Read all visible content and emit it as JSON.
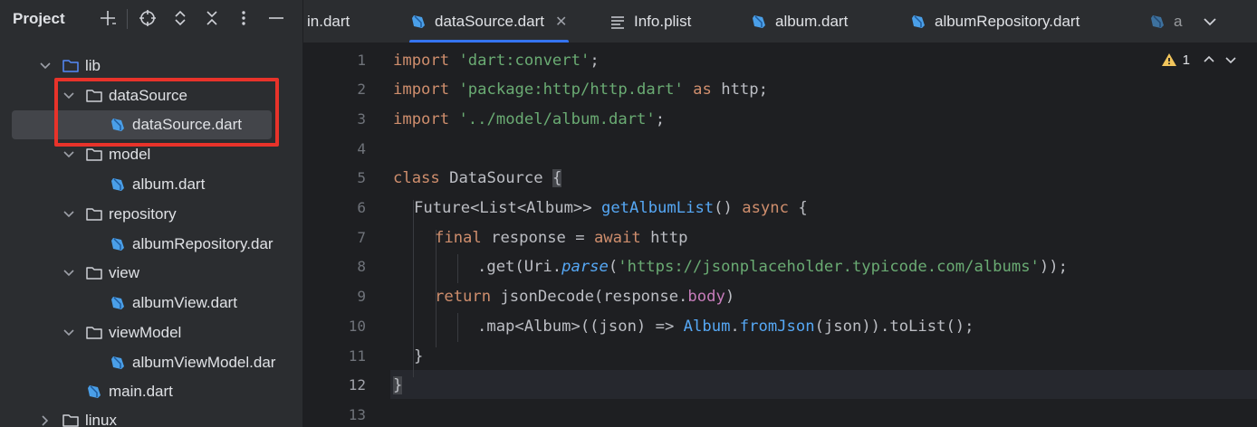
{
  "project_panel": {
    "title": "Project",
    "tree": [
      {
        "label": "lib",
        "type": "folder",
        "expanded": true,
        "depth": 0
      },
      {
        "label": "dataSource",
        "type": "folder",
        "expanded": true,
        "depth": 1
      },
      {
        "label": "dataSource.dart",
        "type": "dart-file",
        "depth": 2,
        "selected": true
      },
      {
        "label": "model",
        "type": "folder",
        "expanded": true,
        "depth": 1
      },
      {
        "label": "album.dart",
        "type": "dart-file",
        "depth": 2
      },
      {
        "label": "repository",
        "type": "folder",
        "expanded": true,
        "depth": 1
      },
      {
        "label": "albumRepository.dar",
        "type": "dart-file",
        "depth": 2
      },
      {
        "label": "view",
        "type": "folder",
        "expanded": true,
        "depth": 1
      },
      {
        "label": "albumView.dart",
        "type": "dart-file",
        "depth": 2
      },
      {
        "label": "viewModel",
        "type": "folder",
        "expanded": true,
        "depth": 1
      },
      {
        "label": "albumViewModel.dar",
        "type": "dart-file",
        "depth": 2
      },
      {
        "label": "main.dart",
        "type": "dart-file",
        "depth": 1
      },
      {
        "label": "linux",
        "type": "folder",
        "expanded": false,
        "depth": 0
      }
    ],
    "header_icons": [
      "add-icon",
      "target-icon",
      "expand-all-icon",
      "collapse-all-icon",
      "more-icon",
      "minimize-icon"
    ]
  },
  "tabs": [
    {
      "label": "in.dart",
      "icon": "none"
    },
    {
      "label": "dataSource.dart",
      "icon": "dart-icon",
      "active": true,
      "close": "✕"
    },
    {
      "label": "Info.plist",
      "icon": "plist-icon"
    },
    {
      "label": "album.dart",
      "icon": "dart-icon"
    },
    {
      "label": "albumRepository.dart",
      "icon": "dart-icon"
    },
    {
      "label": "a",
      "icon": "dart-icon"
    }
  ],
  "editor": {
    "inspection_count": "1",
    "current_line": 12,
    "line_numbers": [
      "1",
      "2",
      "3",
      "4",
      "5",
      "6",
      "7",
      "8",
      "9",
      "10",
      "11",
      "12",
      "13"
    ],
    "code": {
      "l1_kw": "import",
      "l1_str": "'dart:convert'",
      "l1_end": ";",
      "l2_kw": "import",
      "l2_str": "'package:http/http.dart'",
      "l2_as": "as",
      "l2_rest": "http;",
      "l3_kw": "import",
      "l3_str": "'../model/album.dart'",
      "l3_end": ";",
      "l5_kw": "class",
      "l5_name": "DataSource",
      "l5_brace": "{",
      "l6_type": "Future<List<Album>>",
      "l6_fn": "getAlbumList",
      "l6_paren": "()",
      "l6_async": "async",
      "l6_brace": "{",
      "l7_final": "final",
      "l7_mid": "response =",
      "l7_await": "await",
      "l7_rest": "http",
      "l8_a": ".get(Uri.",
      "l8_parse": "parse",
      "l8_b": "(",
      "l8_str": "'https://jsonplaceholder.typicode.com/albums'",
      "l8_c": "));",
      "l9_kw": "return",
      "l9_a": "jsonDecode(response.",
      "l9_prop": "body",
      "l9_b": ")",
      "l10_a": ".map<Album>((json) =>",
      "l10_cls": "Album",
      "l10_dot": ".",
      "l10_fn": "fromJson",
      "l10_b": "(json)).toList();",
      "l11": "}",
      "l12": "}"
    }
  },
  "colors": {
    "highlight_box": "#e8332a",
    "tab_active_underline": "#3574f0",
    "dart_icon": "#4a9fe8"
  }
}
